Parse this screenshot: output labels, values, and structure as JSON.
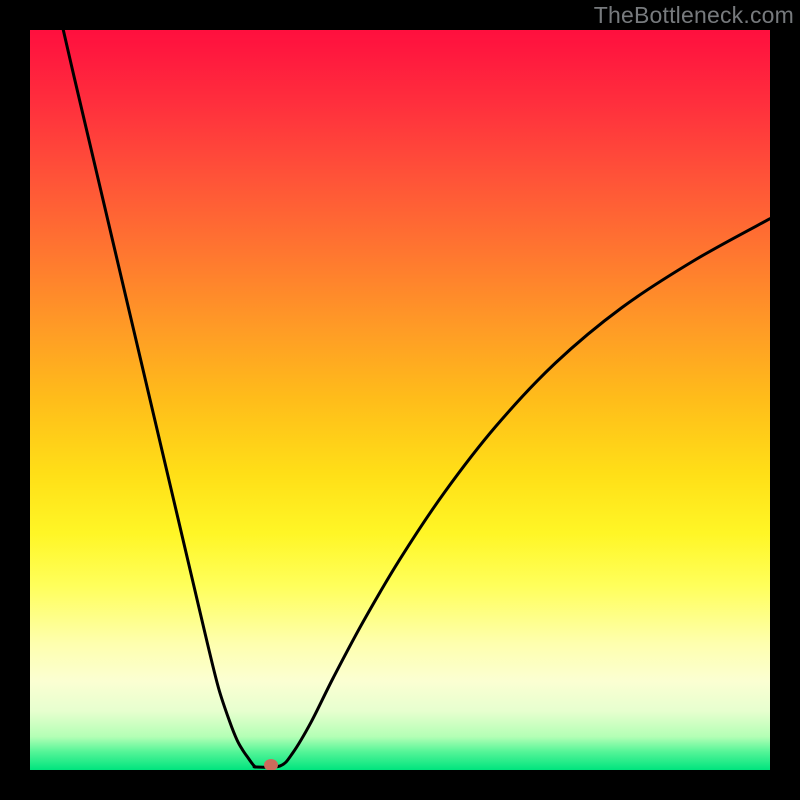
{
  "watermark": "TheBottleneck.com",
  "chart_data": {
    "type": "line",
    "title": "",
    "xlabel": "",
    "ylabel": "",
    "xlim": [
      0,
      100
    ],
    "ylim": [
      0,
      100
    ],
    "background_gradient": {
      "stops": [
        {
          "pos": 0.0,
          "color": "#ff0f3e"
        },
        {
          "pos": 0.1,
          "color": "#ff2f3d"
        },
        {
          "pos": 0.2,
          "color": "#ff5338"
        },
        {
          "pos": 0.3,
          "color": "#ff7630"
        },
        {
          "pos": 0.4,
          "color": "#ff9a26"
        },
        {
          "pos": 0.5,
          "color": "#ffbd1a"
        },
        {
          "pos": 0.6,
          "color": "#ffdf17"
        },
        {
          "pos": 0.68,
          "color": "#fff626"
        },
        {
          "pos": 0.75,
          "color": "#ffff5a"
        },
        {
          "pos": 0.83,
          "color": "#feffaf"
        },
        {
          "pos": 0.88,
          "color": "#fbffd2"
        },
        {
          "pos": 0.92,
          "color": "#e7ffcf"
        },
        {
          "pos": 0.955,
          "color": "#b3ffb5"
        },
        {
          "pos": 0.975,
          "color": "#56f598"
        },
        {
          "pos": 1.0,
          "color": "#00e47e"
        }
      ]
    },
    "series": [
      {
        "name": "bottleneck-curve",
        "x": [
          4.5,
          6,
          8,
          10,
          12,
          14,
          16,
          18,
          20,
          22,
          24,
          25.5,
          27,
          28,
          28.8,
          29.5,
          30,
          30.3,
          30.6,
          33.8,
          35.5,
          38,
          41,
          45,
          50,
          56,
          63,
          71,
          80,
          90,
          100
        ],
        "y": [
          100,
          93.5,
          85,
          76.5,
          68,
          59.5,
          51,
          42.5,
          34,
          25.5,
          17,
          11,
          6.5,
          4,
          2.6,
          1.6,
          0.9,
          0.55,
          0.4,
          0.55,
          2.3,
          6.5,
          12.5,
          20,
          28.5,
          37.5,
          46.5,
          55,
          62.5,
          69,
          74.5
        ]
      }
    ],
    "marker": {
      "x": 32.5,
      "y": 0.7,
      "color": "#cc6b5c"
    }
  }
}
